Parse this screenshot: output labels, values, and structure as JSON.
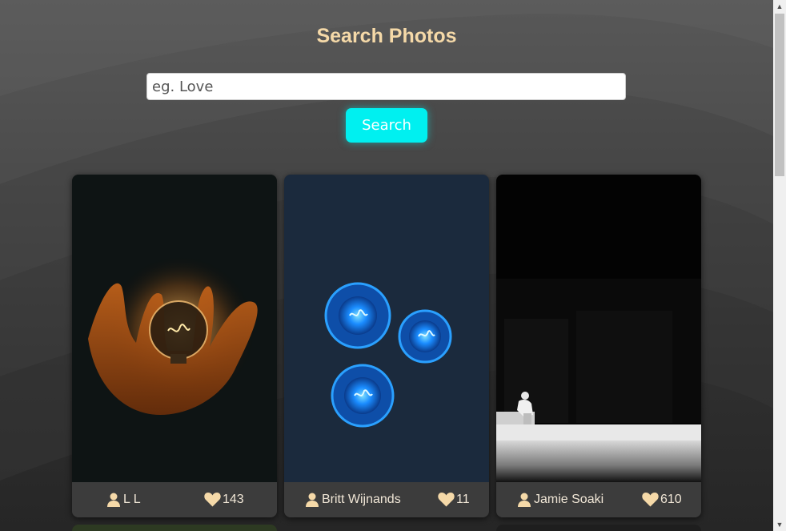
{
  "page": {
    "title": "Search Photos"
  },
  "search": {
    "placeholder": "eg. Love",
    "button_label": "Search"
  },
  "photos": [
    {
      "author": "L L",
      "likes": "143",
      "subject": "hand-holding-lit-bulb"
    },
    {
      "author": "Britt Wijnands",
      "likes": "11",
      "subject": "three-blue-bulbs"
    },
    {
      "author": "Jamie Soaki",
      "likes": "610",
      "subject": "person-sitting-dark-street"
    }
  ],
  "icons": {
    "user": "user-icon",
    "likes": "heart-icon"
  },
  "colors": {
    "title": "#f5d9a8",
    "search_button": "#00f0f0",
    "card_footer": "#3c3c3c",
    "footer_text": "#f0e6d6",
    "heart": "#f5d9a8"
  }
}
